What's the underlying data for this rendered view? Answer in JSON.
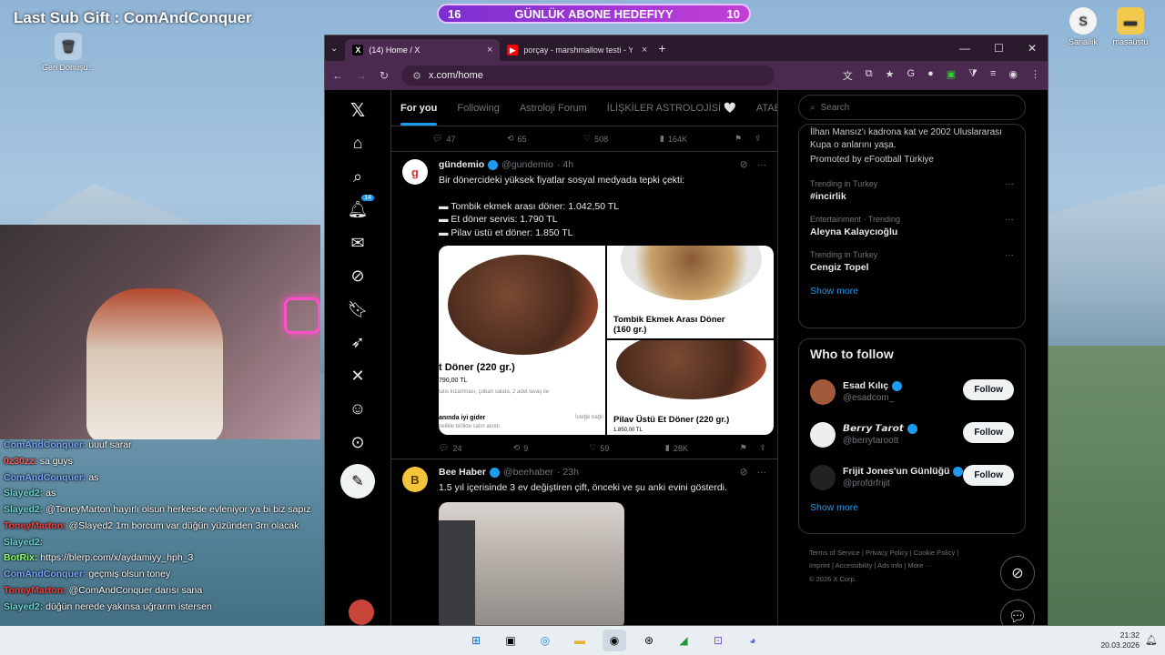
{
  "stream": {
    "title": "Last Sub Gift : ComAndConquer",
    "goal_left": "16",
    "goal_label": "GÜNLÜK ABONE HEDEFIYY",
    "goal_right": "10"
  },
  "desktop": {
    "recycle_label": "Geri Dönüşü...",
    "icon1_label": "Sanallık",
    "icon2_label": "masaüstü"
  },
  "chat": [
    {
      "user": "ComAndConquer:",
      "msg": "uuuf sarar",
      "color": "#7aa8ff"
    },
    {
      "user": "0z30zz:",
      "msg": "sa guys",
      "color": "#ff5a5a"
    },
    {
      "user": "ComAndConquer:",
      "msg": "as",
      "color": "#7aa8ff"
    },
    {
      "user": "Slayed2:",
      "msg": "as",
      "color": "#6fd3d0"
    },
    {
      "user": "Slayed2:",
      "msg": "@ToneyMarton hayırlı olsun herkesde evleniyor ya bi biz sapız",
      "color": "#6fd3d0"
    },
    {
      "user": "ToneyMarton:",
      "msg": "@Slayed2 1m borcum var düğün yüzünden 3m olacak",
      "color": "#ff3a3a"
    },
    {
      "user": "Slayed2:",
      "msg": "",
      "color": "#6fd3d0"
    },
    {
      "user": "BotRix:",
      "msg": "https://blerp.com/x/aydamiyy_hph_3",
      "color": "#8cff6a"
    },
    {
      "user": "ComAndConquer:",
      "msg": "geçmiş olsun toney",
      "color": "#7aa8ff"
    },
    {
      "user": "ToneyMarton:",
      "msg": "@ComAndConquer darısı sana",
      "color": "#ff3a3a"
    },
    {
      "user": "Slayed2:",
      "msg": "düğün nerede yakınsa uğrarım istersen",
      "color": "#6fd3d0"
    }
  ],
  "browser": {
    "tab1": "(14) Home / X",
    "tab2": "porçay - marshmallow testi - YouT",
    "url": "x.com/home"
  },
  "x": {
    "badge": "14",
    "tabs": [
      "For you",
      "Following",
      "Astroloji Forum",
      "İLİŞKİLER ASTROLOJİSİ 🤍",
      "ATABAR"
    ],
    "prev_actions": {
      "replies": "47",
      "reposts": "65",
      "likes": "508",
      "views": "164K"
    },
    "tweet1": {
      "name": "gündemio",
      "handle": "@gundemio",
      "time": "· 4h",
      "line1": "Bir dönercideki yüksek fiyatlar sosyal medyada tepki çekti:",
      "line2": "▬ Tombik ekmek arası döner: 1.042,50 TL",
      "line3": "▬ Et döner servis: 1.790 TL",
      "line4": "▬ Pilav üstü et döner: 1.850 TL",
      "img1_title": "t Döner (220 gr.)",
      "img1_price": "790,00 TL",
      "img1_desc": "tatis kızartması, çoban salata, 2 adet lavaş ile",
      "img1_foot": "anında iyi gider",
      "img1_foot2": "nelikle birlikte satın alındı",
      "img1_extra": "İsteğe bağlı",
      "img2_title": "Tombik Ekmek Arası Döner (160 gr.)",
      "img3_title": "Pilav Üstü Et Döner (220 gr.)",
      "img3_price": "1.850,00 TL",
      "replies": "24",
      "reposts": "9",
      "likes": "59",
      "views": "28K"
    },
    "tweet2": {
      "name": "Bee Haber",
      "handle": "@beehaber",
      "time": "· 23h",
      "text": "1.5 yıl içerisinde 3 ev değiştiren çift, önceki ve şu anki evini gösterdi."
    },
    "search_placeholder": "Search",
    "promo_text": "İlhan Mansız'ı kadrona kat ve 2002 Uluslararası Kupa o anlarını yaşa.",
    "promo_by": "Promoted by eFootball Türkiye",
    "trends": [
      {
        "meta": "Trending in Turkey",
        "title": "#incirlik"
      },
      {
        "meta": "Entertainment · Trending",
        "title": "Aleyna Kalaycıoğlu"
      },
      {
        "meta": "Trending in Turkey",
        "title": "Cengiz Topel"
      }
    ],
    "show_more": "Show more",
    "wtf_title": "Who to follow",
    "follow_label": "Follow",
    "suggestions": [
      {
        "name": "Esad Kılıç",
        "handle": "@esadcom_"
      },
      {
        "name": "𝘽𝙚𝙧𝙧𝙮 𝙏𝙖𝙧𝙤𝙩",
        "handle": "@berrytaroott"
      },
      {
        "name": "Frijit Jones'un Günlüğü",
        "handle": "@profdrfrijit"
      }
    ],
    "footer1": "Terms of Service  |  Privacy Policy  |  Cookie Policy  |",
    "footer2": "Imprint  |  Accessibility  |  Ads info  |  More ···",
    "footer3": "© 2026 X Corp."
  },
  "taskbar": {
    "time": "21:32",
    "date": "20.03.2026"
  }
}
